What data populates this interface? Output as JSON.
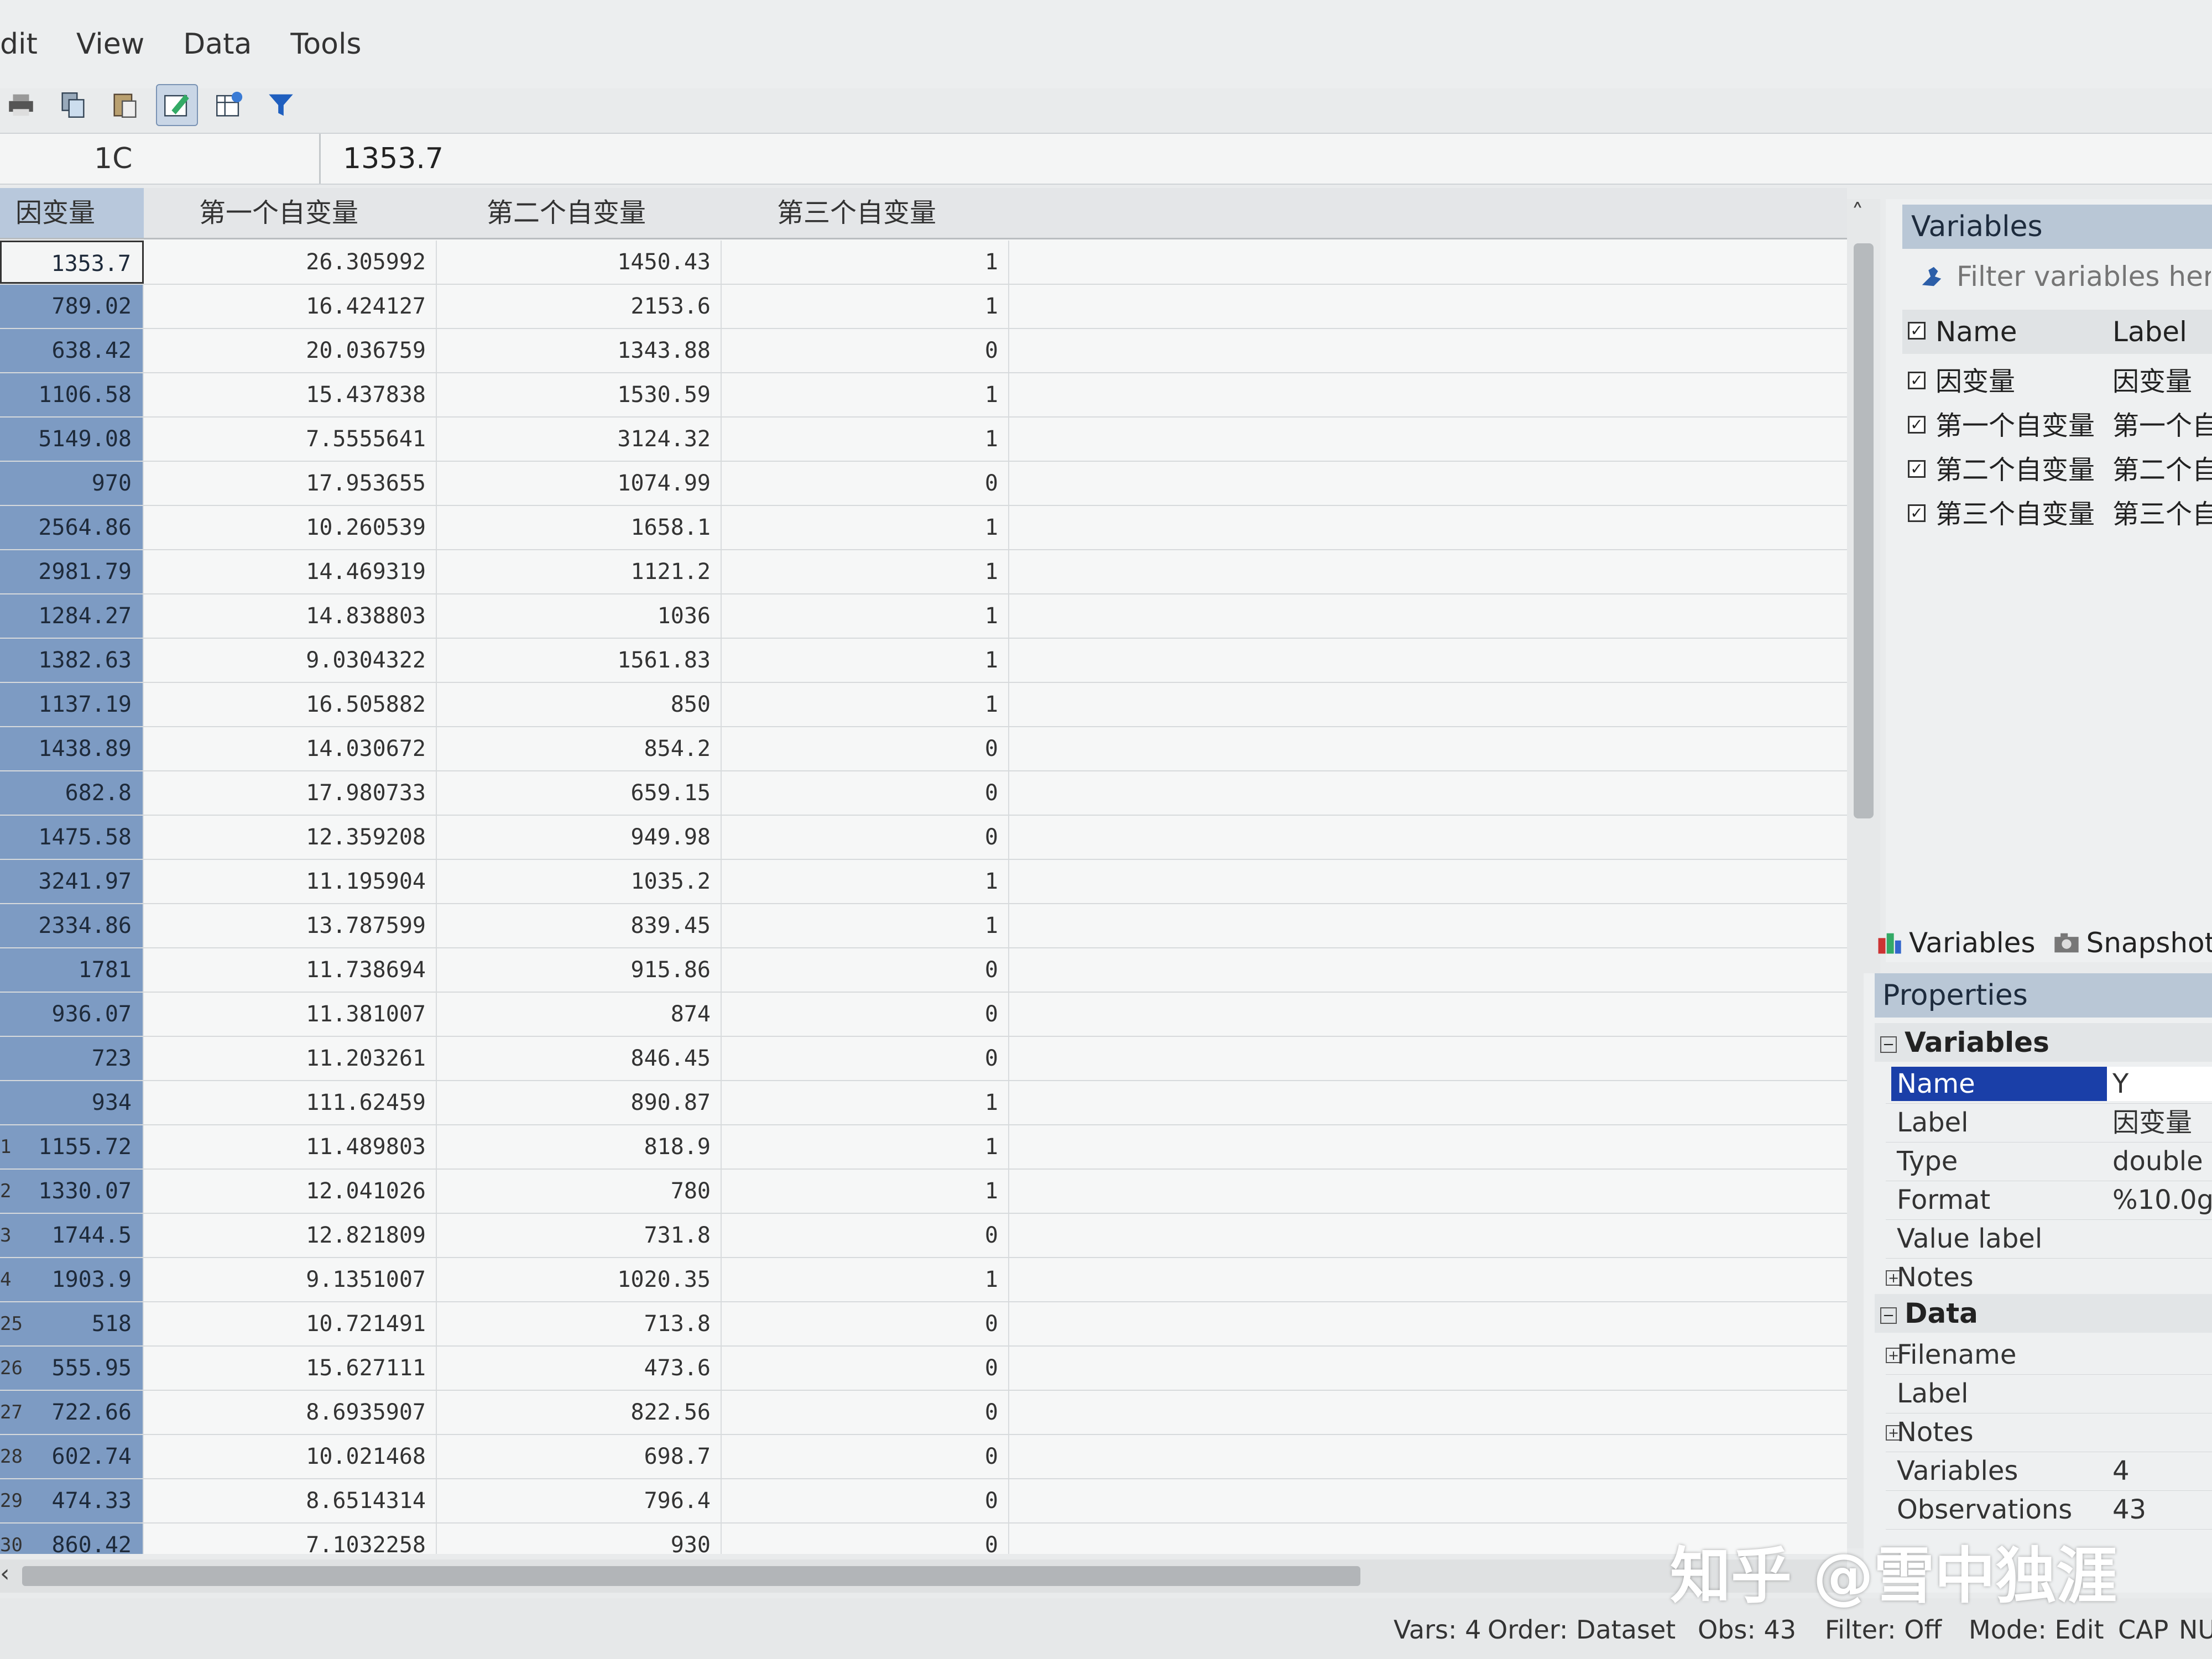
{
  "menu": [
    "dit",
    "View",
    "Data",
    "Tools"
  ],
  "toolbar": {
    "icons": [
      "print-icon",
      "copy-icon",
      "paste-icon",
      "edit-icon",
      "browse-icon",
      "filter-icon"
    ]
  },
  "editbar": {
    "cell_ref": "1C",
    "cell_value": "1353.7"
  },
  "grid": {
    "columns": [
      "因变量",
      "第一个自变量",
      "第二个自变量",
      "第三个自变量"
    ],
    "rows": [
      {
        "n": "",
        "v": [
          "1353.7",
          "26.305992",
          "1450.43",
          "1"
        ]
      },
      {
        "n": "",
        "v": [
          "789.02",
          "16.424127",
          "2153.6",
          "1"
        ]
      },
      {
        "n": "",
        "v": [
          "638.42",
          "20.036759",
          "1343.88",
          "0"
        ]
      },
      {
        "n": "",
        "v": [
          "1106.58",
          "15.437838",
          "1530.59",
          "1"
        ]
      },
      {
        "n": "",
        "v": [
          "5149.08",
          "7.5555641",
          "3124.32",
          "1"
        ]
      },
      {
        "n": "",
        "v": [
          "970",
          "17.953655",
          "1074.99",
          "0"
        ]
      },
      {
        "n": "",
        "v": [
          "2564.86",
          "10.260539",
          "1658.1",
          "1"
        ]
      },
      {
        "n": "",
        "v": [
          "2981.79",
          "14.469319",
          "1121.2",
          "1"
        ]
      },
      {
        "n": "",
        "v": [
          "1284.27",
          "14.838803",
          "1036",
          "1"
        ]
      },
      {
        "n": "",
        "v": [
          "1382.63",
          "9.0304322",
          "1561.83",
          "1"
        ]
      },
      {
        "n": "",
        "v": [
          "1137.19",
          "16.505882",
          "850",
          "1"
        ]
      },
      {
        "n": "",
        "v": [
          "1438.89",
          "14.030672",
          "854.2",
          "0"
        ]
      },
      {
        "n": "",
        "v": [
          "682.8",
          "17.980733",
          "659.15",
          "0"
        ]
      },
      {
        "n": "",
        "v": [
          "1475.58",
          "12.359208",
          "949.98",
          "0"
        ]
      },
      {
        "n": "",
        "v": [
          "3241.97",
          "11.195904",
          "1035.2",
          "1"
        ]
      },
      {
        "n": "",
        "v": [
          "2334.86",
          "13.787599",
          "839.45",
          "1"
        ]
      },
      {
        "n": "",
        "v": [
          "1781",
          "11.738694",
          "915.86",
          "0"
        ]
      },
      {
        "n": "",
        "v": [
          "936.07",
          "11.381007",
          "874",
          "0"
        ]
      },
      {
        "n": "",
        "v": [
          "723",
          "11.203261",
          "846.45",
          "0"
        ]
      },
      {
        "n": "",
        "v": [
          "934",
          "111.62459",
          "890.87",
          "1"
        ]
      },
      {
        "n": "1",
        "v": [
          "1155.72",
          "11.489803",
          "818.9",
          "1"
        ]
      },
      {
        "n": "2",
        "v": [
          "1330.07",
          "12.041026",
          "780",
          "1"
        ]
      },
      {
        "n": "3",
        "v": [
          "1744.5",
          "12.821809",
          "731.8",
          "0"
        ]
      },
      {
        "n": "4",
        "v": [
          "1903.9",
          "9.1351007",
          "1020.35",
          "1"
        ]
      },
      {
        "n": "25",
        "v": [
          "518",
          "10.721491",
          "713.8",
          "0"
        ]
      },
      {
        "n": "26",
        "v": [
          "555.95",
          "15.627111",
          "473.6",
          "0"
        ]
      },
      {
        "n": "27",
        "v": [
          "722.66",
          "8.6935907",
          "822.56",
          "0"
        ]
      },
      {
        "n": "28",
        "v": [
          "602.74",
          "10.021468",
          "698.7",
          "0"
        ]
      },
      {
        "n": "29",
        "v": [
          "474.33",
          "8.6514314",
          "796.4",
          "0"
        ]
      },
      {
        "n": "30",
        "v": [
          "860.42",
          "7.1032258",
          "930",
          "0"
        ]
      }
    ]
  },
  "variables_panel": {
    "title": "Variables",
    "filter_placeholder": "Filter variables here",
    "col_name": "Name",
    "col_label": "Label",
    "items": [
      {
        "name": "因变量",
        "label": "因变量"
      },
      {
        "name": "第一个自变量",
        "label": "第一个自"
      },
      {
        "name": "第二个自变量",
        "label": "第二个自"
      },
      {
        "name": "第三个自变量",
        "label": "第三个自"
      }
    ]
  },
  "tabs": {
    "variables": "Variables",
    "snapshots": "Snapshots"
  },
  "properties": {
    "title": "Properties",
    "variables_section": "Variables",
    "var_rows": [
      {
        "k": "Name",
        "v": "Y"
      },
      {
        "k": "Label",
        "v": "因变量"
      },
      {
        "k": "Type",
        "v": "double"
      },
      {
        "k": "Format",
        "v": "%10.0g"
      },
      {
        "k": "Value label",
        "v": ""
      },
      {
        "k": "Notes",
        "v": ""
      }
    ],
    "data_section": "Data",
    "data_rows": [
      {
        "k": "Filename",
        "v": ""
      },
      {
        "k": "Label",
        "v": ""
      },
      {
        "k": "Notes",
        "v": ""
      },
      {
        "k": "Variables",
        "v": "4"
      },
      {
        "k": "Observations",
        "v": "43"
      }
    ]
  },
  "status": {
    "vars": "Vars: 4",
    "order": "Order: Dataset",
    "obs": "Obs: 43",
    "filter": "Filter: Off",
    "mode": "Mode: Edit",
    "cap": "CAP",
    "num": "NU"
  },
  "watermark": "知乎 @雪中独涯",
  "colors": {
    "selected_column": "#7d9bc3",
    "panel_header": "#b9c7d6",
    "selection": "#1a3fa8"
  }
}
